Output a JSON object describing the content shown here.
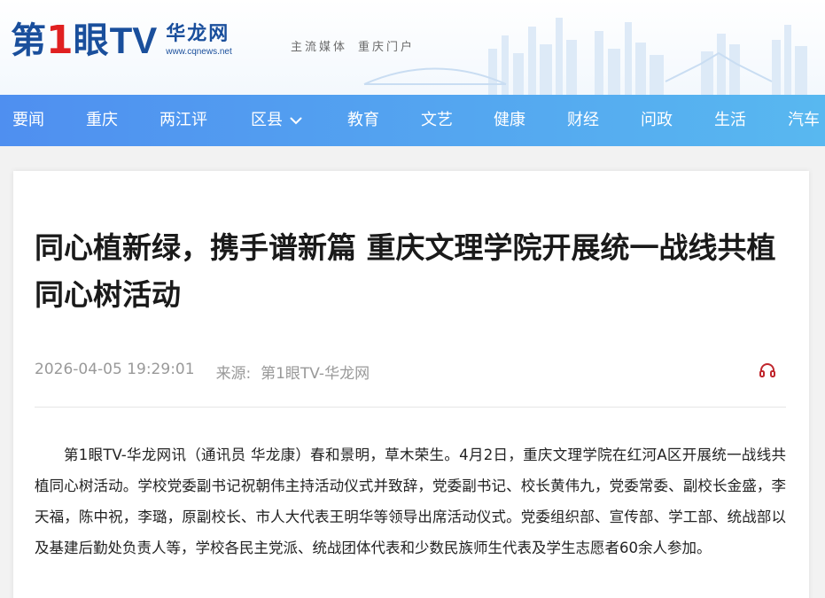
{
  "header": {
    "logo": {
      "brand_prefix": "第",
      "brand_number": "1",
      "brand_middle": "眼",
      "brand_tv": "TV",
      "site_name": "华龙网",
      "site_url": "www.cqnews.net"
    },
    "slogan": [
      "主流媒体",
      "重庆门户"
    ]
  },
  "nav": {
    "items": [
      {
        "label": "要闻"
      },
      {
        "label": "重庆"
      },
      {
        "label": "两江评"
      },
      {
        "label": "区县",
        "has_dropdown": true
      },
      {
        "label": "教育"
      },
      {
        "label": "文艺"
      },
      {
        "label": "健康"
      },
      {
        "label": "财经"
      },
      {
        "label": "问政"
      },
      {
        "label": "生活"
      },
      {
        "label": "汽车"
      }
    ]
  },
  "article": {
    "title": "同心植新绿，携手谱新篇 重庆文理学院开展统一战线共植同心树活动",
    "datetime": "2026-04-05 19:29:01",
    "source": "来源:  第1眼TV-华龙网",
    "listen_icon": "headphones-icon",
    "paragraph": "第1眼TV-华龙网讯（通讯员 华龙康）春和景明，草木荣生。4月2日，重庆文理学院在红河A区开展统一战线共植同心树活动。学校党委副书记祝朝伟主持活动仪式并致辞，党委副书记、校长黄伟九，党委常委、副校长金盛，李天福，陈中祝，李璐，原副校长、市人大代表王明华等领导出席活动仪式。党委组织部、宣传部、学工部、统战部以及基建后勤处负责人等，学校各民主党派、统战团体代表和少数民族师生代表及学生志愿者60余人参加。"
  },
  "colors": {
    "brand_blue": "#1a4f9c",
    "brand_red": "#e02020",
    "nav_start": "#4f8ff0",
    "nav_end": "#58b8f0",
    "listen_icon": "#c0272d"
  }
}
